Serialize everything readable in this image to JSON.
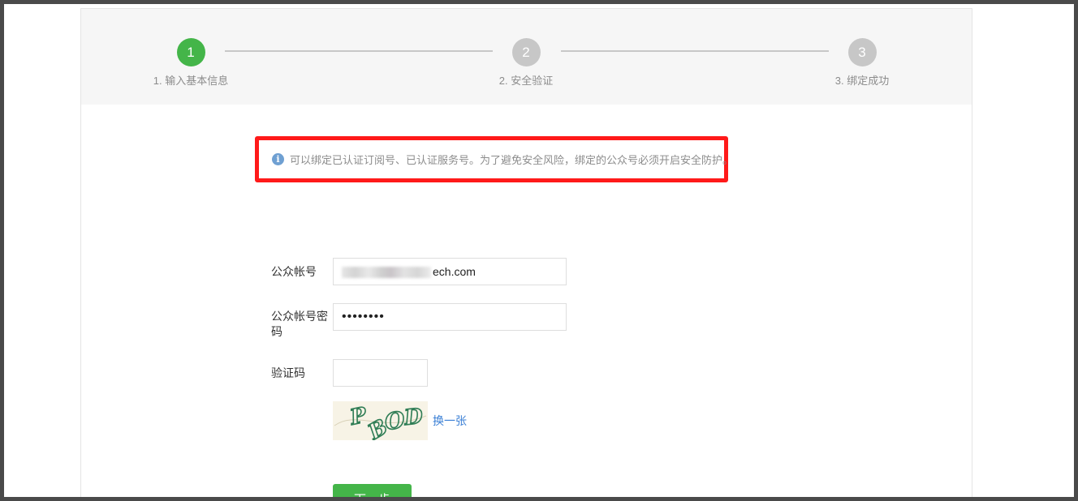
{
  "steps": [
    {
      "number": "1",
      "label": "1. 输入基本信息",
      "active": true
    },
    {
      "number": "2",
      "label": "2. 安全验证",
      "active": false
    },
    {
      "number": "3",
      "label": "3. 绑定成功",
      "active": false
    }
  ],
  "tip": {
    "icon": "info-icon",
    "text": "可以绑定已认证订阅号、已认证服务号。为了避免安全风险，绑定的公众号必须开启安全防护。"
  },
  "form": {
    "account_label": "公众帐号",
    "account_value_suffix": "ech.com",
    "password_label": "公众帐号密码",
    "password_value": "••••••••",
    "captcha_label": "验证码",
    "captcha_value": "",
    "captcha_text": "PBOD",
    "refresh_link": "换一张"
  },
  "next_button": "下一步",
  "colors": {
    "accent_green": "#44b549",
    "highlight_red": "#ff1a1a",
    "link_blue": "#3a7fd5"
  }
}
